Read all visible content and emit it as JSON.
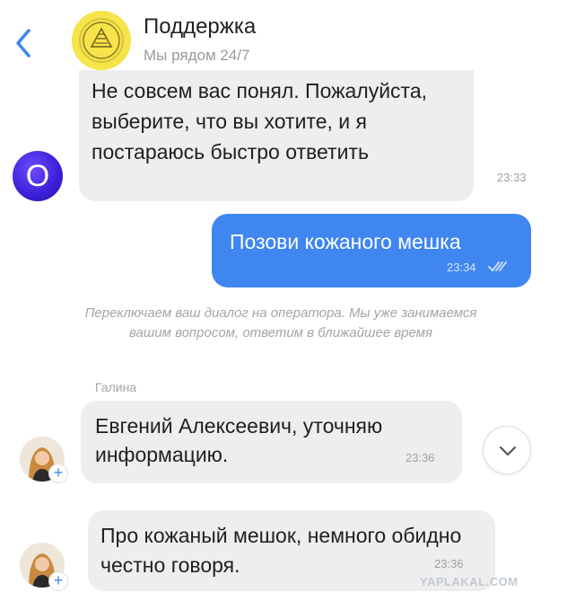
{
  "header": {
    "title": "Поддержка",
    "subtitle": "Мы рядом 24/7",
    "back_icon": "chevron-left-icon",
    "avatar_icon": "bank-logo-icon"
  },
  "messages": [
    {
      "from": "bot",
      "text": "Не совсем вас понял. Пожалуйста, выберите, что вы хотите, и я постараюсь быстро ответить",
      "time": "23:33",
      "avatar_letter": "О"
    },
    {
      "from": "user",
      "text": "Позови кожаного мешка",
      "time": "23:34",
      "status_icon": "double-check-icon"
    },
    {
      "from": "operator",
      "sender": "Галина",
      "text": "Евгений Алексеевич, уточняю информацию.",
      "time": "23:36"
    },
    {
      "from": "operator",
      "text": "Про кожаный мешок, немного обидно честно говоря.",
      "time": "23:36"
    }
  ],
  "system_note": "Переключаем ваш диалог на оператора. Мы уже занимаемся вашим вопросом, ответим в ближайшее время",
  "operator_avatar_badge": "+",
  "scroll_button_icon": "chevron-down-icon",
  "watermark": "YAPLAKAL.COM",
  "colors": {
    "user_bubble": "#3f86f0",
    "incoming_bubble": "#eeeeee",
    "bot_avatar": "#3a1fd6",
    "header_avatar": "#f7e34a"
  }
}
